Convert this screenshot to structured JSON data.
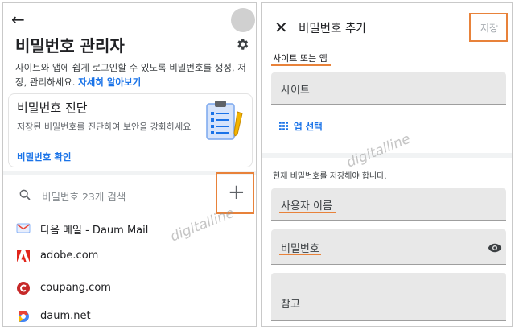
{
  "left": {
    "title": "비밀번호 관리자",
    "description": "사이트와 앱에 쉽게 로그인할 수 있도록 비밀번호를 생성, 저장, 관리하세요.",
    "learn_more": "자세히 알아보기",
    "checkup": {
      "title": "비밀번호 진단",
      "subtitle": "저장된 비밀번호를 진단하여 보안을 강화하세요",
      "action": "비밀번호 확인"
    },
    "search_placeholder": "비밀번호 23개 검색",
    "add_symbol": "+",
    "entries": [
      {
        "label": "다음 메일 - Daum Mail",
        "icon": "daum-mail-icon"
      },
      {
        "label": "adobe.com",
        "icon": "adobe-icon"
      },
      {
        "label": "coupang.com",
        "icon": "coupang-icon"
      },
      {
        "label": "daum.net",
        "icon": "daum-icon"
      }
    ],
    "watermark": "digitalline"
  },
  "right": {
    "title": "비밀번호 추가",
    "save": "저장",
    "section": "사이트 또는 앱",
    "site_placeholder": "사이트",
    "select_app": "앱 선택",
    "help": "현재 비밀번호를 저장해야 합니다.",
    "username_placeholder": "사용자 이름",
    "password_placeholder": "비밀번호",
    "note_placeholder": "참고",
    "watermark": "digitalline"
  },
  "colors": {
    "accent": "#1a73e8",
    "highlight": "#e8823a",
    "field_bg": "#e8e8e8"
  }
}
